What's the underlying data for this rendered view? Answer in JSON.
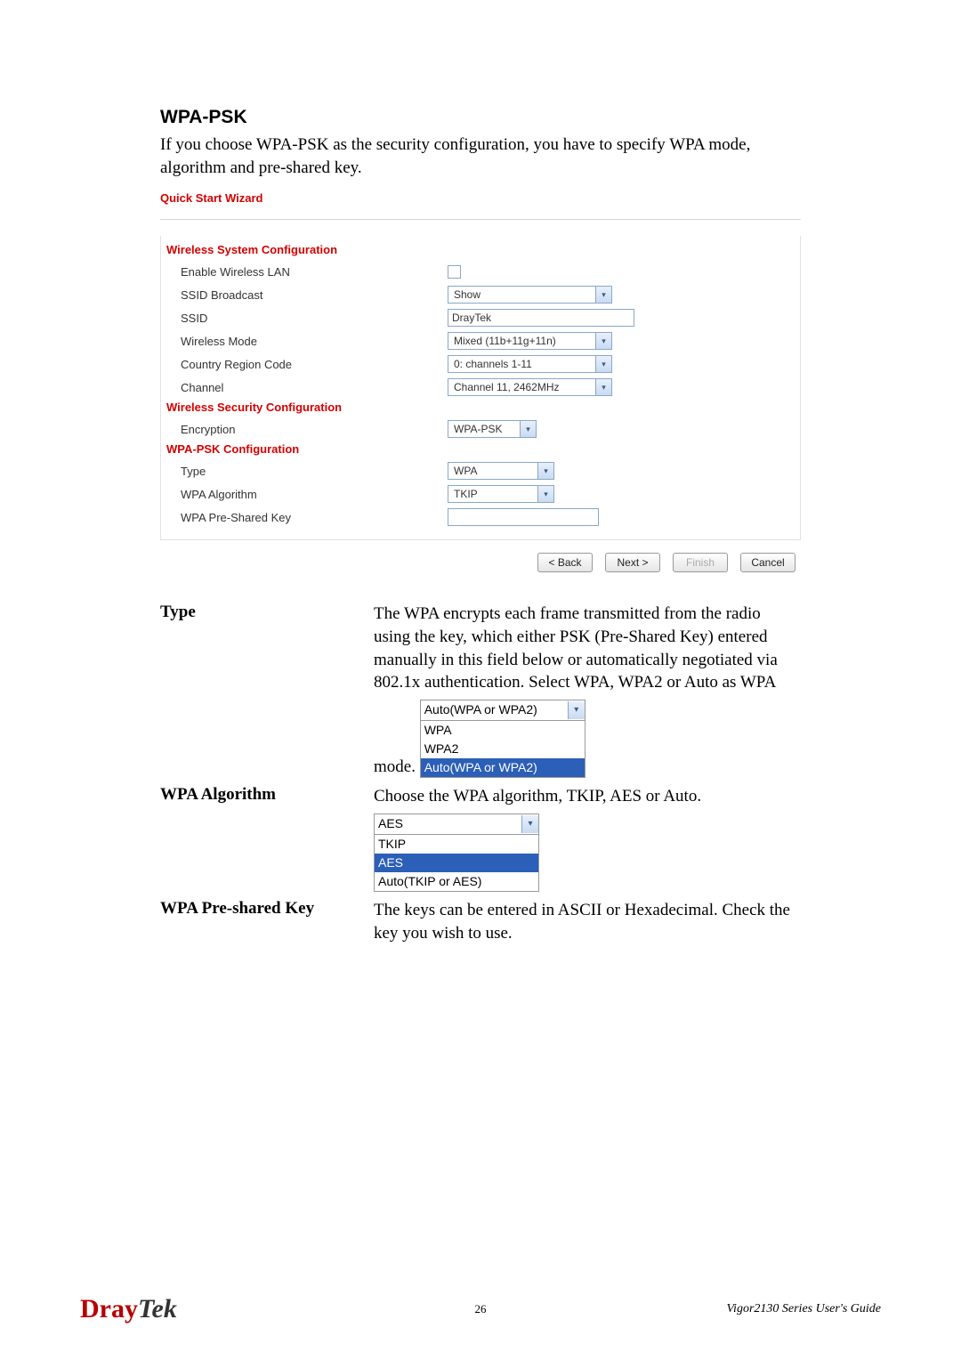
{
  "title": "WPA-PSK",
  "intro": "If you choose WPA-PSK as the security configuration, you have to specify WPA mode, algorithm and pre-shared key.",
  "wizard": {
    "title": "Quick Start Wizard",
    "sys_head": "Wireless System Configuration",
    "rows": {
      "enable_label": "Enable Wireless LAN",
      "ssid_bcast_label": "SSID Broadcast",
      "ssid_bcast_value": "Show",
      "ssid_label": "SSID",
      "ssid_value": "DrayTek",
      "mode_label": "Wireless Mode",
      "mode_value": "Mixed (11b+11g+11n)",
      "region_label": "Country Region Code",
      "region_value": "0: channels 1-11",
      "channel_label": "Channel",
      "channel_value": "Channel 11, 2462MHz"
    },
    "sec_head": "Wireless Security Configuration",
    "enc_label": "Encryption",
    "enc_value": "WPA-PSK",
    "psk_head": "WPA-PSK Configuration",
    "type_label": "Type",
    "type_value": "WPA",
    "algo_label": "WPA Algorithm",
    "algo_value": "TKIP",
    "key_label": "WPA Pre-Shared Key",
    "buttons": {
      "back": "< Back",
      "next": "Next >",
      "finish": "Finish",
      "cancel": "Cancel"
    }
  },
  "defs": {
    "type_term": "Type",
    "type_body": "The WPA encrypts each frame transmitted from the radio using the key, which either PSK (Pre-Shared Key) entered manually in this field below or automatically negotiated via 802.1x authentication. Select WPA, WPA2 or Auto as WPA mode.",
    "type_dd": {
      "selected": "Auto(WPA or WPA2)",
      "options": [
        "WPA",
        "WPA2",
        "Auto(WPA or WPA2)"
      ],
      "hi_index": 2
    },
    "algo_term": "WPA Algorithm",
    "algo_body": "Choose the WPA algorithm, TKIP, AES or Auto.",
    "algo_dd": {
      "selected": "AES",
      "options": [
        "TKIP",
        "AES",
        "Auto(TKIP or AES)"
      ],
      "hi_index": 1
    },
    "key_term": "WPA Pre-shared Key",
    "key_body": "The keys can be entered in ASCII or Hexadecimal. Check the key you wish to use."
  },
  "footer": {
    "brand1": "Dray",
    "brand2": "Tek",
    "page": "26",
    "guide": "Vigor2130  Series  User's  Guide"
  }
}
